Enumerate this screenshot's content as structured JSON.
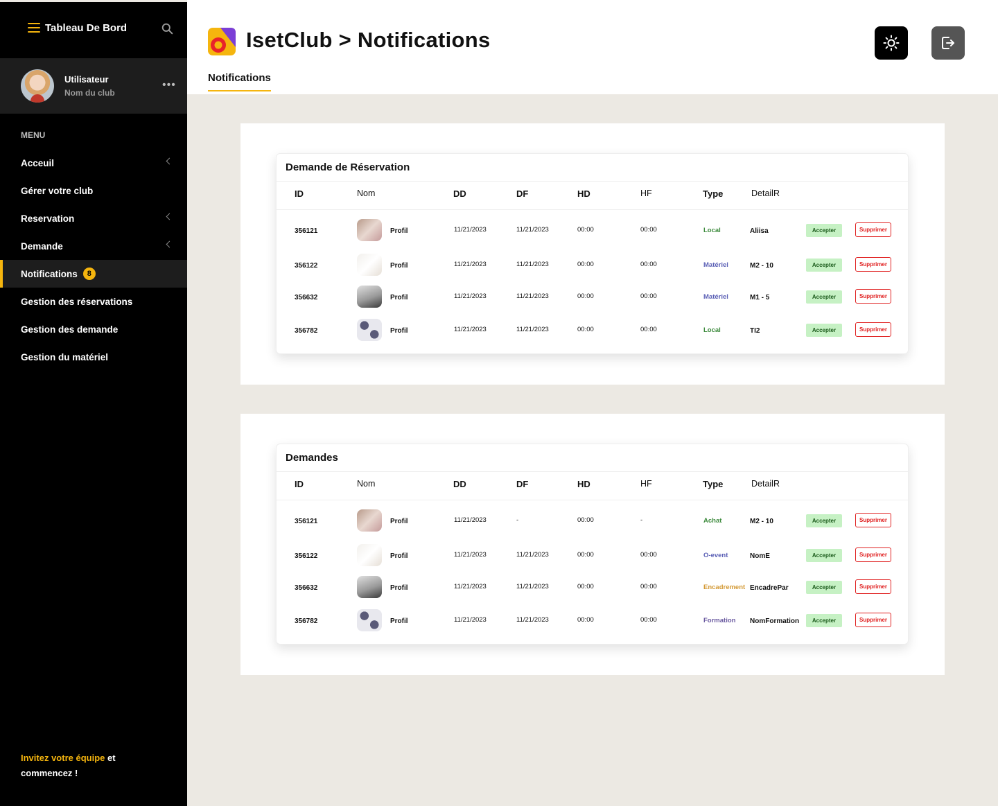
{
  "sidebar": {
    "title": "Tableau De Bord",
    "user": {
      "name": "Utilisateur",
      "club": "Nom du club",
      "more": "•••"
    },
    "menu_label": "MENU",
    "items": [
      {
        "label": "Acceuil",
        "chevron": true
      },
      {
        "label": "Gérer votre club",
        "chevron": false
      },
      {
        "label": "Reservation",
        "chevron": true
      },
      {
        "label": "Demande",
        "chevron": true
      },
      {
        "label": "Notifications",
        "badge": "8",
        "active": true
      },
      {
        "label": "Gestion des réservations"
      },
      {
        "label": "Gestion des demande"
      },
      {
        "label": "Gestion du matériel"
      }
    ],
    "invite": {
      "highlight": "Invitez votre équipe",
      "rest1": " et",
      "rest2": "commencez !"
    }
  },
  "header": {
    "title": "IsetClub > Notifications",
    "tab": "Notifications",
    "icons": {
      "theme": "sun-icon",
      "logout": "logout-icon"
    }
  },
  "columns": [
    "ID",
    "Nom",
    "DD",
    "DF",
    "HD",
    "HF",
    "Type",
    "DetailR"
  ],
  "colors": {
    "accent": "#f5b50e",
    "local": "#3c8a3c",
    "materiel": "#5a5fb5",
    "achat": "#3c8a3c",
    "oevent": "#5a5fb5",
    "encadrement": "#d49a36",
    "formation": "#6a5aa0"
  },
  "actions": {
    "accept": "Accepter",
    "delete": "Supprimer"
  },
  "reservations": {
    "title": "Demande de Réservation",
    "rows": [
      {
        "id": "356121",
        "nom": "Profil",
        "dd": "11/21/2023",
        "df": "11/21/2023",
        "hd": "00:00",
        "hf": "00:00",
        "type": "Local",
        "detail": "Aliisa"
      },
      {
        "id": "356122",
        "nom": "Profil",
        "dd": "11/21/2023",
        "df": "11/21/2023",
        "hd": "00:00",
        "hf": "00:00",
        "type": "Matériel",
        "detail": "M2 - 10"
      },
      {
        "id": "356632",
        "nom": "Profil",
        "dd": "11/21/2023",
        "df": "11/21/2023",
        "hd": "00:00",
        "hf": "00:00",
        "type": "Matériel",
        "detail": "M1 - 5"
      },
      {
        "id": "356782",
        "nom": "Profil",
        "dd": "11/21/2023",
        "df": "11/21/2023",
        "hd": "00:00",
        "hf": "00:00",
        "type": "Local",
        "detail": "TI2"
      }
    ]
  },
  "demandes": {
    "title": "Demandes",
    "rows": [
      {
        "id": "356121",
        "nom": "Profil",
        "dd": "11/21/2023",
        "df": "-",
        "hd": "00:00",
        "hf": "-",
        "type": "Achat",
        "detail": "M2 - 10"
      },
      {
        "id": "356122",
        "nom": "Profil",
        "dd": "11/21/2023",
        "df": "11/21/2023",
        "hd": "00:00",
        "hf": "00:00",
        "type": "O-event",
        "detail": "NomE"
      },
      {
        "id": "356632",
        "nom": "Profil",
        "dd": "11/21/2023",
        "df": "11/21/2023",
        "hd": "00:00",
        "hf": "00:00",
        "type": "Encadrement",
        "detail": "EncadrePar"
      },
      {
        "id": "356782",
        "nom": "Profil",
        "dd": "11/21/2023",
        "df": "11/21/2023",
        "hd": "00:00",
        "hf": "00:00",
        "type": "Formation",
        "detail": "NomFormation"
      }
    ]
  }
}
